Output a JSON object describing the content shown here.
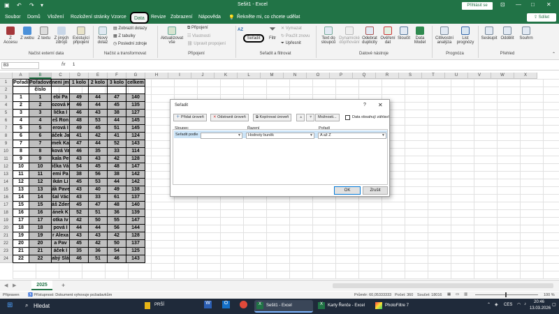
{
  "titlebar": {
    "title": "Sešit1 - Excel",
    "signin": "Přihlásit se",
    "autosave_label": "",
    "window_controls": [
      "—",
      "□",
      "✕"
    ]
  },
  "menu": {
    "items": [
      "Soubor",
      "Domů",
      "Vložení",
      "Rozložení stránky",
      "Vzorce",
      "Data",
      "Revize",
      "Zobrazení",
      "Nápověda"
    ],
    "active": "Data",
    "tell_me": "Řekněte mi, co chcete udělat",
    "share": "Sdílet"
  },
  "ribbon": {
    "get_data": [
      "Z Accesu",
      "Z webu",
      "Z textu",
      "Z jiných zdrojů",
      "Existující připojení"
    ],
    "group_external": "Načíst externí data",
    "new_query": "Nový dotaz",
    "show_queries": "Zobrazit dotazy",
    "from_table": "Z tabulky",
    "recent_sources": "Poslední zdroje",
    "group_transform": "Načíst a transformovat",
    "refresh_all": "Aktualizovat vše",
    "connections": "Připojení",
    "properties": "Vlastnosti",
    "edit_links": "Upravit propojení",
    "group_connections": "Připojení",
    "sort_az": "AZ",
    "sort": "Seřadit",
    "filter": "Filtr",
    "clear": "Vymazat",
    "reapply": "Použít znovu",
    "advanced": "Upřesnit",
    "group_sort": "Seřadit a filtrovat",
    "text_to_columns": "Text do sloupců",
    "flash_fill": "Dynamické doplňování",
    "remove_duplicates": "Odebrat duplicity",
    "data_validation": "Ověření dat",
    "consolidate": "Sloučit",
    "data_model": "Data Model",
    "group_tools": "Datové nástroje",
    "what_if": "Citlivostní analýza",
    "forecast_sheet": "List prognózy",
    "group_forecast": "Prognóza",
    "group": "Seskupit",
    "ungroup": "Oddělit",
    "subtotal": "Souhrn",
    "group_outline": "Přehled"
  },
  "formula_bar": {
    "name_box": "B3",
    "fx": "fx",
    "value": "1"
  },
  "columns": [
    "A",
    "B",
    "C",
    "D",
    "E",
    "F",
    "G",
    "H",
    "I",
    "J",
    "K",
    "L",
    "M",
    "N",
    "O",
    "P",
    "Q",
    "R",
    "S",
    "T",
    "U",
    "V",
    "W",
    "X"
  ],
  "table": {
    "headers": [
      "Pořadí",
      "Pořadové",
      "neni jm",
      "1 kolo",
      "2 kolo",
      "3 kolo",
      "celkem"
    ],
    "header2": "číslo",
    "rows": [
      [
        "1",
        "1",
        "ebi Pa",
        "49",
        "44",
        "47",
        "140"
      ],
      [
        "2",
        "2",
        "ozová K",
        "46",
        "44",
        "45",
        "135"
      ],
      [
        "3",
        "3",
        "lička I",
        "46",
        "43",
        "38",
        "127"
      ],
      [
        "4",
        "4",
        "eš Ron",
        "48",
        "53",
        "44",
        "145"
      ],
      [
        "5",
        "5",
        "erová I",
        "49",
        "45",
        "51",
        "145"
      ],
      [
        "6",
        "6",
        "áček Ja",
        "41",
        "42",
        "41",
        "124"
      ],
      [
        "7",
        "7",
        "mek Ka",
        "47",
        "44",
        "52",
        "143"
      ],
      [
        "8",
        "8",
        "ková Va",
        "46",
        "35",
        "33",
        "114"
      ],
      [
        "9",
        "9",
        "kala Pe",
        "43",
        "43",
        "42",
        "128"
      ],
      [
        "10",
        "10",
        "ička Vá",
        "54",
        "45",
        "48",
        "147"
      ],
      [
        "11",
        "11",
        "emi Pa",
        "38",
        "56",
        "38",
        "142"
      ],
      [
        "12",
        "12",
        "ikán Li",
        "45",
        "53",
        "44",
        "142"
      ],
      [
        "13",
        "13",
        "ák Pave",
        "43",
        "40",
        "49",
        "138"
      ],
      [
        "14",
        "14",
        "šal Vác",
        "43",
        "33",
        "61",
        "137"
      ],
      [
        "15",
        "15",
        "áš Zder",
        "45",
        "47",
        "48",
        "140"
      ],
      [
        "16",
        "16",
        "ánek K",
        "52",
        "51",
        "36",
        "139"
      ],
      [
        "17",
        "17",
        "otka Iv",
        "42",
        "50",
        "55",
        "147"
      ],
      [
        "18",
        "18",
        "pová I",
        "44",
        "44",
        "56",
        "144"
      ],
      [
        "19",
        "19",
        "r Alexa",
        "43",
        "43",
        "42",
        "128"
      ],
      [
        "20",
        "20",
        "a Pav",
        "45",
        "42",
        "50",
        "137"
      ],
      [
        "21",
        "21",
        "áček I",
        "35",
        "36",
        "54",
        "125"
      ],
      [
        "22",
        "22",
        "abý Slá",
        "46",
        "51",
        "46",
        "143"
      ]
    ],
    "row_numbers": [
      "1",
      "2",
      "3",
      "4",
      "5",
      "6",
      "7",
      "8",
      "9",
      "10",
      "11",
      "12",
      "13",
      "14",
      "15",
      "16",
      "17",
      "18",
      "19",
      "20",
      "21",
      "22",
      "23",
      "24"
    ]
  },
  "dialog": {
    "title": "Seřadit",
    "help": "?",
    "close": "✕",
    "add_level": "Přidat úroveň",
    "delete_level": "Odstranit úroveň",
    "copy_level": "Kopírovat úroveň",
    "options": "Možnosti...",
    "has_headers": "Data obsahují záhlaví",
    "col_header": "Sloupec",
    "sort_on_header": "Řazení",
    "order_header": "Pořadí",
    "row_label": "Seřadit podle",
    "column_value": "",
    "sort_on_value": "Hodnoty buněk",
    "order_value": "A až Z",
    "ok": "OK",
    "cancel": "Zrušit"
  },
  "sheet_tabs": {
    "active": "2025",
    "add": "+"
  },
  "status": {
    "ready": "Připraven",
    "accessibility": "Přístupnost: Dokument vyhovuje požadavkům",
    "average": "Průměr: 60,05333333",
    "count": "Počet: 360",
    "sum": "Součet: 18016",
    "zoom": "100 %"
  },
  "taskbar": {
    "search": "Hledat",
    "apps": [
      "PRŠÍ",
      "Sešit1 - Excel",
      "Karty Řenče - Excel",
      "PhotoFiltre 7"
    ],
    "lang": "CES",
    "time": "20:46",
    "date": "13.03.2026"
  },
  "colors": {
    "excel_green": "#217346",
    "taskbar": "#1f2a3a",
    "cell_gray": "#bfbfbf",
    "dialog_selected_row": "#cce4f7"
  }
}
